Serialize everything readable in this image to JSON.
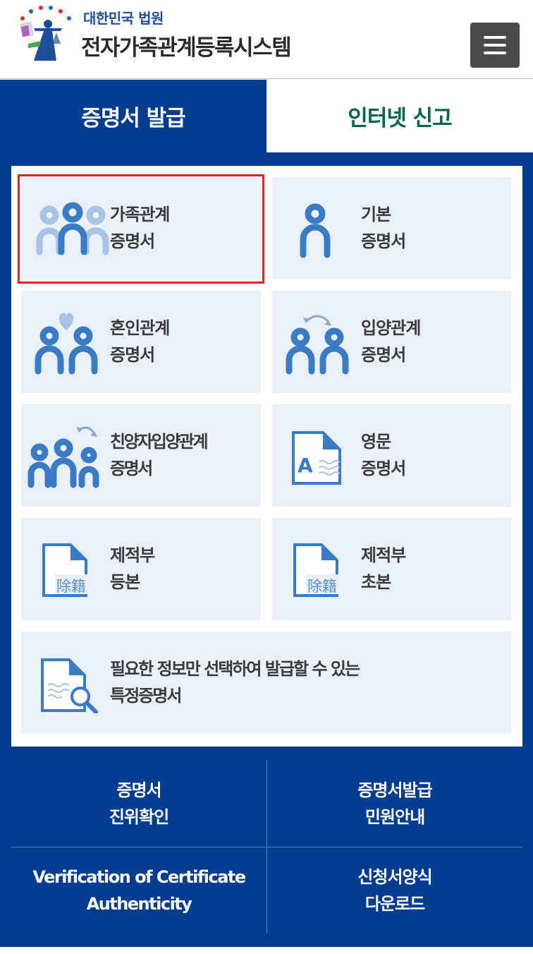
{
  "header": {
    "org_name": "대한민국 법원",
    "system_name": "전자가족관계등록시스템",
    "menu_icon": "hamburger-menu-icon"
  },
  "tabs": [
    {
      "label": "증명서 발급",
      "active": true
    },
    {
      "label": "인터넷 신고",
      "active": false
    }
  ],
  "cards": [
    {
      "line1": "가족관계",
      "line2": "증명서",
      "icon": "family-icon",
      "selected": true
    },
    {
      "line1": "기본",
      "line2": "증명서",
      "icon": "person-icon"
    },
    {
      "line1": "혼인관계",
      "line2": "증명서",
      "icon": "marriage-icon"
    },
    {
      "line1": "입양관계",
      "line2": "증명서",
      "icon": "adoption-icon"
    },
    {
      "line1": "친양자입양관계",
      "line2": "증명서",
      "icon": "full-adoption-icon"
    },
    {
      "line1": "영문",
      "line2": "증명서",
      "icon": "english-document-icon"
    },
    {
      "line1": "제적부",
      "line2": "등본",
      "icon": "removed-register-icon",
      "icon_text": "除籍"
    },
    {
      "line1": "제적부",
      "line2": "초본",
      "icon": "removed-register-icon",
      "icon_text": "除籍"
    },
    {
      "line1": "필요한 정보만 선택하여 발급할 수 있는",
      "line2": "특정증명서",
      "icon": "document-search-icon"
    }
  ],
  "bottom_links": [
    {
      "line1": "증명서",
      "line2": "진위확인"
    },
    {
      "line1": "증명서발급",
      "line2": "민원안내"
    },
    {
      "line1": "Verification of Certificate",
      "line2": "Authenticity"
    },
    {
      "line1": "신청서양식",
      "line2": "다운로드"
    }
  ],
  "colors": {
    "primary_blue": "#003c8f",
    "icon_blue": "#3a7bc8",
    "icon_light_blue": "#a7c4e6",
    "card_bg": "#eaf0f8",
    "report_tab_text": "#006653",
    "selection_outline": "#e0262b"
  }
}
